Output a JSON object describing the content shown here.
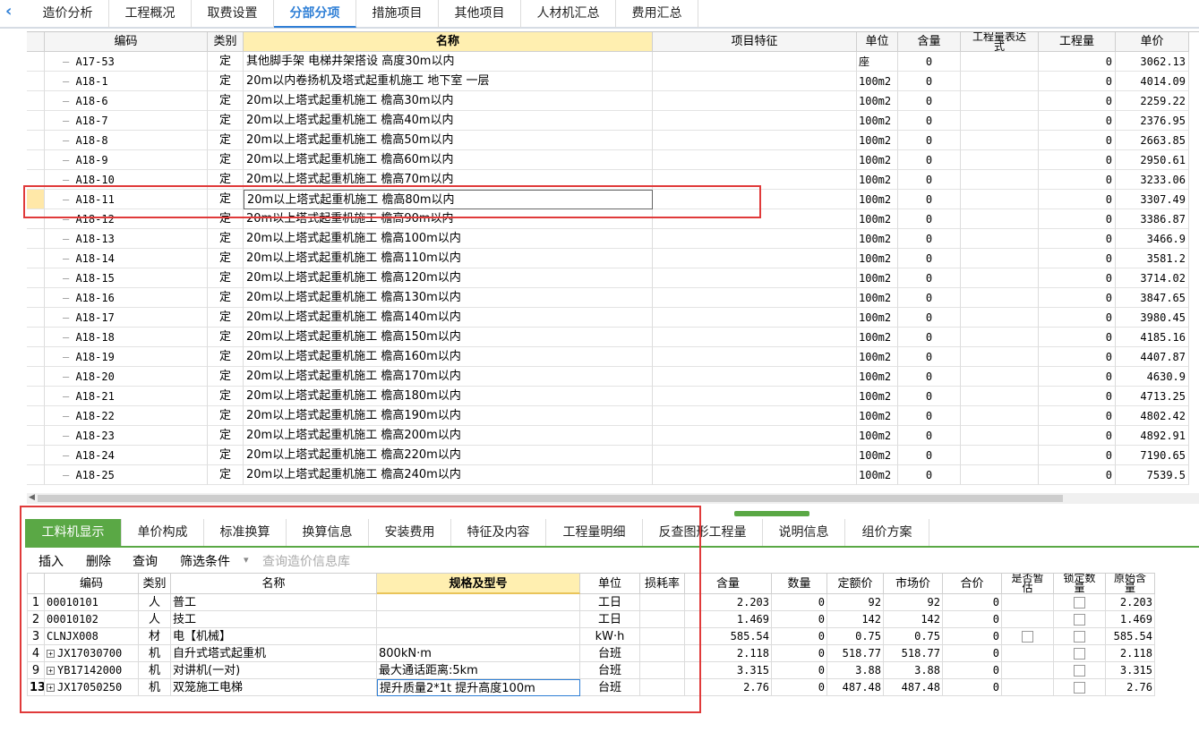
{
  "top_tabs": [
    {
      "label": "造价分析"
    },
    {
      "label": "工程概况"
    },
    {
      "label": "取费设置"
    },
    {
      "label": "分部分项"
    },
    {
      "label": "措施项目"
    },
    {
      "label": "其他项目"
    },
    {
      "label": "人材机汇总"
    },
    {
      "label": "费用汇总"
    }
  ],
  "active_top_tab": "分部分项",
  "upper_headers": {
    "code": "编码",
    "type": "类别",
    "name": "名称",
    "feature": "项目特征",
    "unit": "单位",
    "content": "含量",
    "expr": "工程量表达式",
    "qty": "工程量",
    "price": "单价"
  },
  "upper_rows": [
    {
      "code": "A17-53",
      "type": "定",
      "name": "其他脚手架 电梯井架搭设 高度30m以内",
      "unit": "座",
      "content": "0",
      "qty": "0",
      "price": "3062.13"
    },
    {
      "code": "A18-1",
      "type": "定",
      "name": "20m以内卷扬机及塔式起重机施工 地下室 一层",
      "unit": "100m2",
      "content": "0",
      "qty": "0",
      "price": "4014.09"
    },
    {
      "code": "A18-6",
      "type": "定",
      "name": "20m以上塔式起重机施工 檐高30m以内",
      "unit": "100m2",
      "content": "0",
      "qty": "0",
      "price": "2259.22"
    },
    {
      "code": "A18-7",
      "type": "定",
      "name": "20m以上塔式起重机施工 檐高40m以内",
      "unit": "100m2",
      "content": "0",
      "qty": "0",
      "price": "2376.95"
    },
    {
      "code": "A18-8",
      "type": "定",
      "name": "20m以上塔式起重机施工 檐高50m以内",
      "unit": "100m2",
      "content": "0",
      "qty": "0",
      "price": "2663.85"
    },
    {
      "code": "A18-9",
      "type": "定",
      "name": "20m以上塔式起重机施工 檐高60m以内",
      "unit": "100m2",
      "content": "0",
      "qty": "0",
      "price": "2950.61"
    },
    {
      "code": "A18-10",
      "type": "定",
      "name": "20m以上塔式起重机施工 檐高70m以内",
      "unit": "100m2",
      "content": "0",
      "qty": "0",
      "price": "3233.06"
    },
    {
      "code": "A18-11",
      "type": "定",
      "name": "20m以上塔式起重机施工 檐高80m以内",
      "unit": "100m2",
      "content": "0",
      "qty": "0",
      "price": "3307.49"
    },
    {
      "code": "A18-12",
      "type": "定",
      "name": "20m以上塔式起重机施工 檐高90m以内",
      "unit": "100m2",
      "content": "0",
      "qty": "0",
      "price": "3386.87"
    },
    {
      "code": "A18-13",
      "type": "定",
      "name": "20m以上塔式起重机施工 檐高100m以内",
      "unit": "100m2",
      "content": "0",
      "qty": "0",
      "price": "3466.9"
    },
    {
      "code": "A18-14",
      "type": "定",
      "name": "20m以上塔式起重机施工 檐高110m以内",
      "unit": "100m2",
      "content": "0",
      "qty": "0",
      "price": "3581.2"
    },
    {
      "code": "A18-15",
      "type": "定",
      "name": "20m以上塔式起重机施工 檐高120m以内",
      "unit": "100m2",
      "content": "0",
      "qty": "0",
      "price": "3714.02"
    },
    {
      "code": "A18-16",
      "type": "定",
      "name": "20m以上塔式起重机施工 檐高130m以内",
      "unit": "100m2",
      "content": "0",
      "qty": "0",
      "price": "3847.65"
    },
    {
      "code": "A18-17",
      "type": "定",
      "name": "20m以上塔式起重机施工 檐高140m以内",
      "unit": "100m2",
      "content": "0",
      "qty": "0",
      "price": "3980.45"
    },
    {
      "code": "A18-18",
      "type": "定",
      "name": "20m以上塔式起重机施工 檐高150m以内",
      "unit": "100m2",
      "content": "0",
      "qty": "0",
      "price": "4185.16"
    },
    {
      "code": "A18-19",
      "type": "定",
      "name": "20m以上塔式起重机施工 檐高160m以内",
      "unit": "100m2",
      "content": "0",
      "qty": "0",
      "price": "4407.87"
    },
    {
      "code": "A18-20",
      "type": "定",
      "name": "20m以上塔式起重机施工 檐高170m以内",
      "unit": "100m2",
      "content": "0",
      "qty": "0",
      "price": "4630.9"
    },
    {
      "code": "A18-21",
      "type": "定",
      "name": "20m以上塔式起重机施工 檐高180m以内",
      "unit": "100m2",
      "content": "0",
      "qty": "0",
      "price": "4713.25"
    },
    {
      "code": "A18-22",
      "type": "定",
      "name": "20m以上塔式起重机施工 檐高190m以内",
      "unit": "100m2",
      "content": "0",
      "qty": "0",
      "price": "4802.42"
    },
    {
      "code": "A18-23",
      "type": "定",
      "name": "20m以上塔式起重机施工 檐高200m以内",
      "unit": "100m2",
      "content": "0",
      "qty": "0",
      "price": "4892.91"
    },
    {
      "code": "A18-24",
      "type": "定",
      "name": "20m以上塔式起重机施工 檐高220m以内",
      "unit": "100m2",
      "content": "0",
      "qty": "0",
      "price": "7190.65"
    },
    {
      "code": "A18-25",
      "type": "定",
      "name": "20m以上塔式起重机施工 檐高240m以内",
      "unit": "100m2",
      "content": "0",
      "qty": "0",
      "price": "7539.5"
    }
  ],
  "selected_code": "A18-11",
  "sub_tabs": [
    {
      "label": "工料机显示"
    },
    {
      "label": "单价构成"
    },
    {
      "label": "标准换算"
    },
    {
      "label": "换算信息"
    },
    {
      "label": "安装费用"
    },
    {
      "label": "特征及内容"
    },
    {
      "label": "工程量明细"
    },
    {
      "label": "反查图形工程量"
    },
    {
      "label": "说明信息"
    },
    {
      "label": "组价方案"
    }
  ],
  "toolbar": {
    "insert": "插入",
    "delete": "删除",
    "query": "查询",
    "filter": "筛选条件",
    "filter_arrow": "▾",
    "query_price_db": "查询造价信息库"
  },
  "lower_headers": {
    "code": "编码",
    "type": "类别",
    "name": "名称",
    "spec": "规格及型号",
    "unit": "单位",
    "loss": "损耗率",
    "content": "含量",
    "qty": "数量",
    "quota_price": "定额价",
    "market_price": "市场价",
    "total": "合价",
    "estimate_top": "是否暂",
    "estimate_bottom": "估",
    "lock_top": "锁定数",
    "lock_bottom": "量",
    "orig_top": "原始含",
    "orig_bottom": "量"
  },
  "lower_rows": [
    {
      "idx": "1",
      "code": "00010101",
      "expand": false,
      "type": "人",
      "name": "普工",
      "spec": "",
      "unit": "工日",
      "content": "2.203",
      "qty": "0",
      "quota": "92",
      "market": "92",
      "total": "0",
      "estimate_box": false,
      "lock_box": true,
      "orig": "2.203"
    },
    {
      "idx": "2",
      "code": "00010102",
      "expand": false,
      "type": "人",
      "name": "技工",
      "spec": "",
      "unit": "工日",
      "content": "1.469",
      "qty": "0",
      "quota": "142",
      "market": "142",
      "total": "0",
      "estimate_box": false,
      "lock_box": true,
      "orig": "1.469"
    },
    {
      "idx": "3",
      "code": "CLNJX008",
      "expand": false,
      "type": "材",
      "name": "电【机械】",
      "spec": "",
      "unit": "kW·h",
      "content": "585.54",
      "qty": "0",
      "quota": "0.75",
      "market": "0.75",
      "total": "0",
      "estimate_box": true,
      "lock_box": true,
      "orig": "585.54"
    },
    {
      "idx": "4",
      "code": "JX17030700",
      "expand": true,
      "type": "机",
      "name": "自升式塔式起重机",
      "spec": "800kN·m",
      "unit": "台班",
      "content": "2.118",
      "qty": "0",
      "quota": "518.77",
      "market": "518.77",
      "total": "0",
      "estimate_box": false,
      "lock_box": true,
      "orig": "2.118"
    },
    {
      "idx": "9",
      "code": "YB17142000",
      "expand": true,
      "type": "机",
      "name": "对讲机(一对)",
      "spec": "最大通话距离:5km",
      "unit": "台班",
      "content": "3.315",
      "qty": "0",
      "quota": "3.88",
      "market": "3.88",
      "total": "0",
      "estimate_box": false,
      "lock_box": true,
      "orig": "3.315"
    },
    {
      "idx": "13",
      "code": "JX17050250",
      "expand": true,
      "type": "机",
      "name": "双笼施工电梯",
      "spec": "提升质量2*1t 提升高度100m",
      "unit": "台班",
      "content": "2.76",
      "qty": "0",
      "quota": "487.48",
      "market": "487.48",
      "total": "0",
      "estimate_box": false,
      "lock_box": true,
      "orig": "2.76"
    }
  ],
  "colors": {
    "accent": "#2f7fd6",
    "active_subtab": "#5aa845",
    "highlight_header": "#ffefb0",
    "annotation_red": "#e03a3a"
  }
}
